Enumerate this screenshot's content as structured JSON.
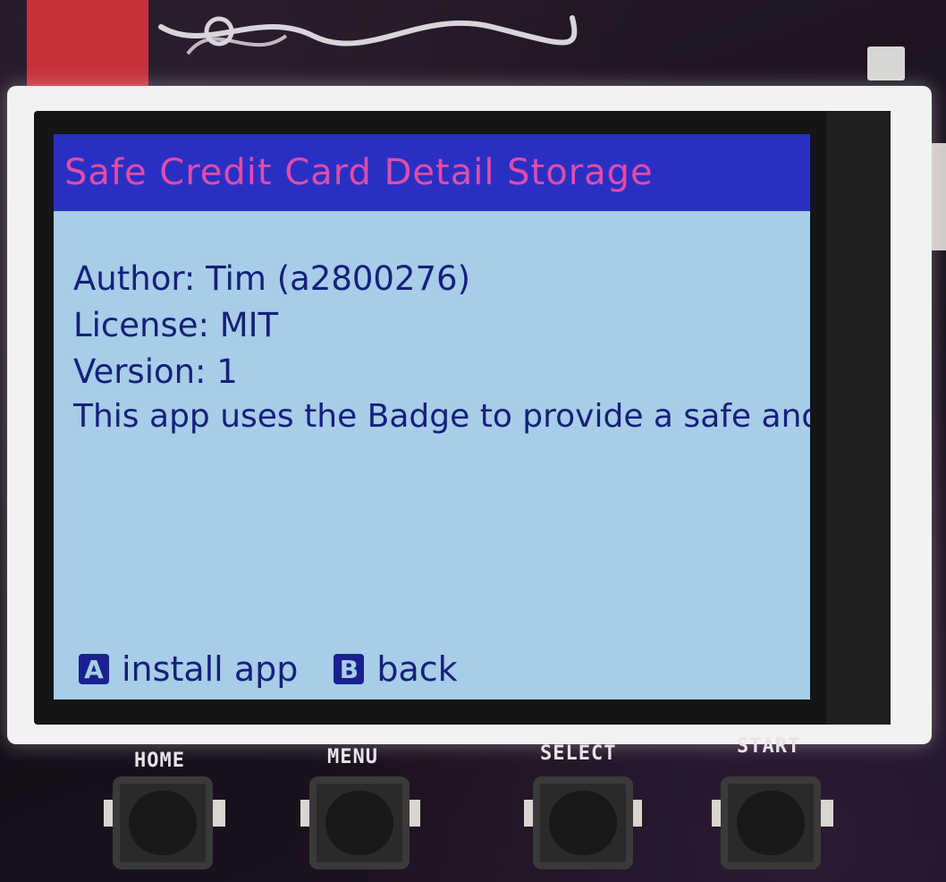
{
  "screen": {
    "title": "Safe Credit Card Detail Storage",
    "author_line": "Author: Tim (a2800276)",
    "license_line": "License: MIT",
    "version_line": "Version: 1",
    "description": "This app uses the Badge to provide a safe and secure password and payment card storage. It is totally legit.",
    "footer": {
      "a_key": "A",
      "a_action": "install app",
      "b_key": "B",
      "b_action": "back"
    }
  },
  "hardware_buttons": [
    {
      "label": "HOME"
    },
    {
      "label": "MENU"
    },
    {
      "label": "SELECT"
    },
    {
      "label": "START"
    }
  ],
  "colors": {
    "title_bar": "#2a2fc4",
    "title_text": "#e04ca8",
    "screen_bg": "#a7cde8",
    "body_text": "#16207a"
  }
}
